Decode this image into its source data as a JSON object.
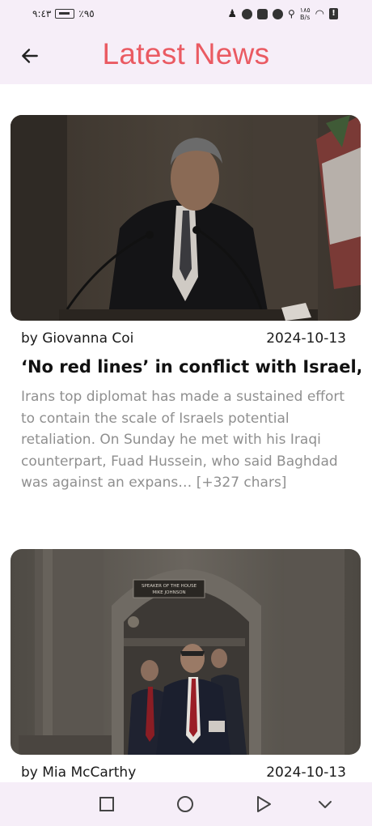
{
  "status_bar": {
    "time": "٩:٤٣",
    "battery": "٪٩٥",
    "net_speed_value": "١٨٥",
    "net_speed_unit": "B/s"
  },
  "app_bar": {
    "title": "Latest News",
    "back_icon": "arrow-left-icon"
  },
  "articles": [
    {
      "author": "by Giovanna Coi",
      "date": "2024-10-13",
      "title": "‘No red lines’ in conflict with Israel,",
      "description": "Irans top diplomat has made a sustained effort to contain the scale of Israels potential retaliation. On Sunday he met with his Iraqi counterpart, Fuad Hussein, who said Baghdad was against an expans… [+327 chars]"
    },
    {
      "author": "by Mia McCarthy",
      "date": "2024-10-13"
    }
  ],
  "image_text": {
    "sign_line1": "SPEAKER OF THE HOUSE",
    "sign_line2": "MIKE JOHNSON"
  },
  "nav_bar": {
    "icons": [
      "recent-apps-icon",
      "home-icon",
      "back-icon",
      "collapse-icon"
    ]
  }
}
